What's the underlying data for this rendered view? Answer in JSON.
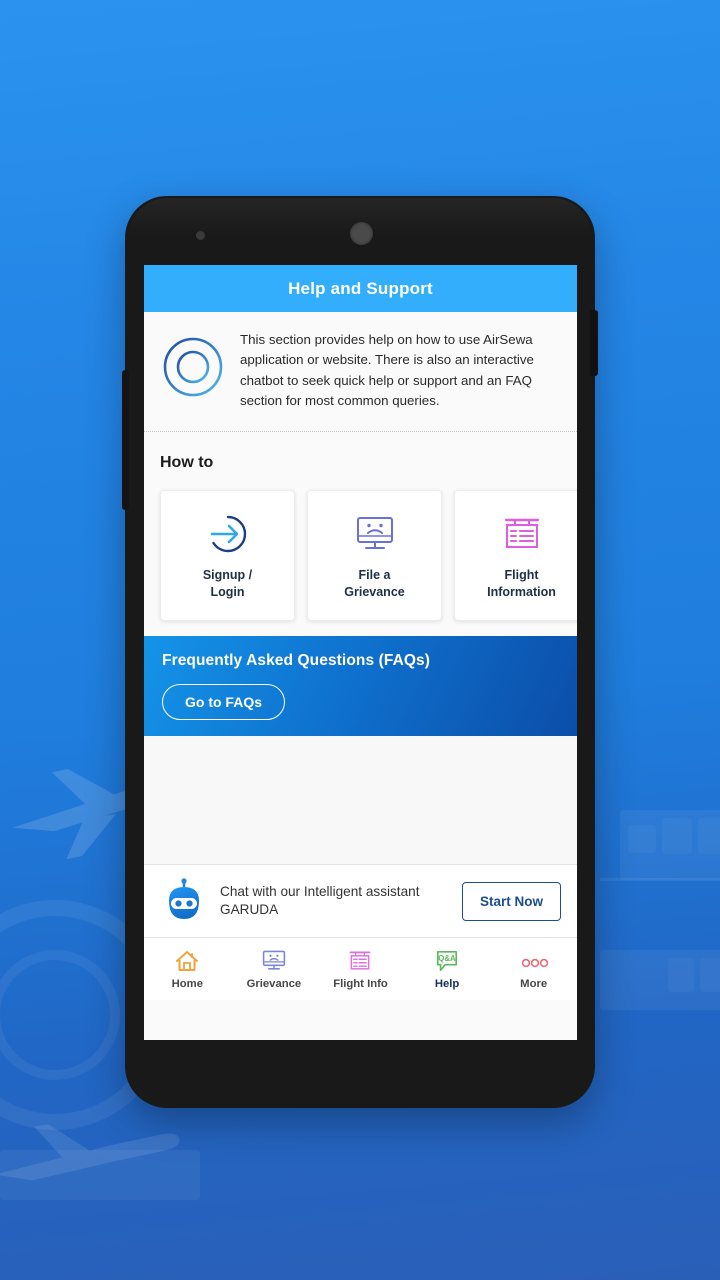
{
  "app": {
    "header_title": "Help and Support",
    "header_color": "#33aefc"
  },
  "intro": {
    "icon": "lifebuoy-icon",
    "text": "This section provides help on how to use AirSewa application or website. There is also an interactive chatbot to seek quick help or support and an FAQ section for most common queries."
  },
  "howto": {
    "title": "How to",
    "cards": [
      {
        "icon": "login-arrow-icon",
        "label": "Signup /\nLogin",
        "line1": "Signup /",
        "line2": "Login",
        "color": "#1d3f87"
      },
      {
        "icon": "monitor-sad-face-icon",
        "label": "File a\nGrievance",
        "line1": "File a",
        "line2": "Grievance",
        "color": "#6b70d8"
      },
      {
        "icon": "flight-board-icon",
        "label": "Flight\nInformation",
        "line1": "Flight",
        "line2": "Information",
        "color": "#e25ce2"
      }
    ]
  },
  "faq": {
    "title": "Frequently Asked Questions (FAQs)",
    "button_label": "Go to FAQs"
  },
  "chatbot": {
    "icon": "robot-icon",
    "line1": "Chat with our Intelligent assistant",
    "line2": "GARUDA",
    "button_label": "Start Now",
    "button_color": "#1b4e8f"
  },
  "navbar": {
    "items": [
      {
        "icon": "home-icon",
        "label": "Home",
        "color": "#f0a33c",
        "active": false
      },
      {
        "icon": "monitor-sad-face-icon",
        "label": "Grievance",
        "color": "#7b86d6",
        "active": false
      },
      {
        "icon": "flight-board-icon",
        "label": "Flight Info",
        "color": "#e06fe0",
        "active": false
      },
      {
        "icon": "qa-speech-bubble-icon",
        "label": "Help",
        "color": "#5cb85c",
        "active": true
      },
      {
        "icon": "more-dots-icon",
        "label": "More",
        "color": "#e8697a",
        "active": false
      }
    ]
  }
}
